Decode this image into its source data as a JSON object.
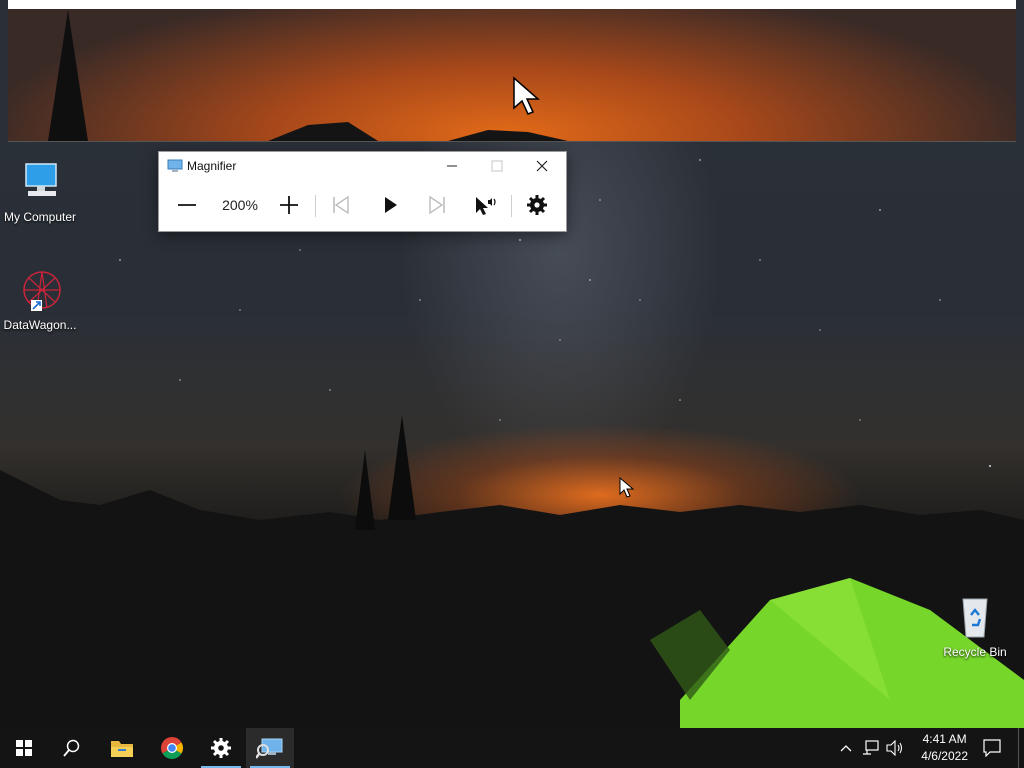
{
  "magnifier": {
    "title": "Magnifier",
    "zoom_level": "200%",
    "buttons": [
      "zoom-out",
      "zoom-in",
      "previous",
      "play",
      "next",
      "read-from-here",
      "settings"
    ]
  },
  "desktop": {
    "icons": [
      {
        "label": "My Computer",
        "icon": "computer-icon"
      },
      {
        "label": "DataWagon...",
        "icon": "datawagon-shortcut-icon"
      },
      {
        "label": "Recycle Bin",
        "icon": "recycle-bin-icon"
      }
    ]
  },
  "taskbar": {
    "items": [
      "start-icon",
      "search-icon",
      "file-explorer-icon",
      "chrome-icon",
      "settings-icon",
      "magnifier-icon"
    ],
    "clock": {
      "time": "4:41 AM",
      "date": "4/6/2022"
    },
    "accent": "#76b9ed"
  }
}
